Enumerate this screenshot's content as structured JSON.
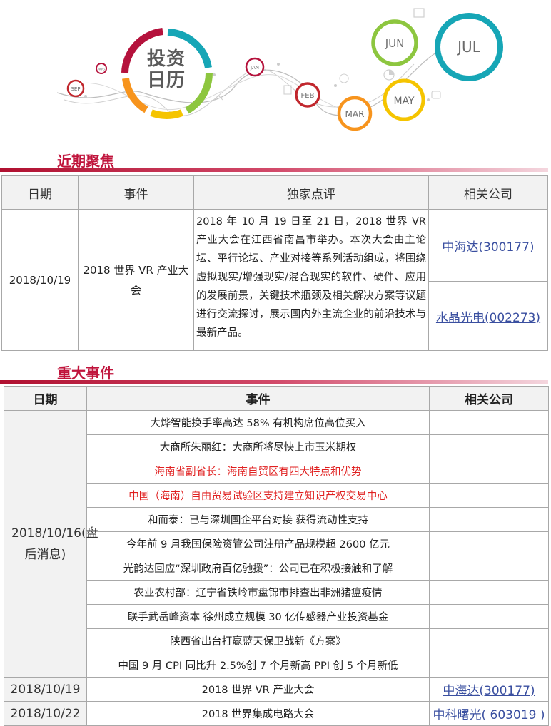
{
  "banner": {
    "brand_line1": "投资",
    "brand_line2": "日历",
    "months": {
      "sep": "SEP",
      "aug": "AUG",
      "jan": "JAN",
      "feb": "FEB",
      "mar": "MAR",
      "may": "MAY",
      "jun": "JUN",
      "jul": "JUL"
    },
    "colors": {
      "jun": "#8dc63f",
      "jul": "#16a6b6",
      "may": "#f5c400",
      "mar": "#f7941d",
      "feb": "#c1272d",
      "jan": "#b5123c",
      "sep": "#c1272d",
      "aug": "#b5123c"
    }
  },
  "focus": {
    "title": "近期聚焦",
    "headers": [
      "日期",
      "事件",
      "独家点评",
      "相关公司"
    ],
    "row": {
      "date": "2018/10/19",
      "event": "2018 世界 VR 产业大会",
      "comment": "2018 年 10 月 19 日至 21 日，2018 世界 VR 产业大会在江西省南昌市举办。本次大会由主论坛、平行论坛、产业对接等系列活动组成，将围绕虚拟现实/增强现实/混合现实的软件、硬件、应用的发展前景，关键技术瓶颈及相关解决方案等议题进行交流探讨，展示国内外主流企业的前沿技术与最新产品。",
      "companies": [
        "中海达(300177)",
        "水晶光电(002273)"
      ]
    }
  },
  "major": {
    "title": "重大事件",
    "headers": [
      "日期",
      "事件",
      "相关公司"
    ],
    "group_date": "2018/10/16(盘后消息)",
    "group_events": [
      {
        "text": "大烨智能换手率高达 58%  有机构席位高位买入",
        "highlight": false
      },
      {
        "text": "大商所朱丽红：大商所将尽快上市玉米期权",
        "highlight": false
      },
      {
        "text": "海南省副省长：海南自贸区有四大特点和优势",
        "highlight": true
      },
      {
        "text": "中国（海南）自由贸易试验区支持建立知识产权交易中心",
        "highlight": true
      },
      {
        "text": "和而泰：已与深圳国企平台对接  获得流动性支持",
        "highlight": false
      },
      {
        "text": "今年前 9 月我国保险资管公司注册产品规模超 2600 亿元",
        "highlight": false
      },
      {
        "text": "光韵达回应“深圳政府百亿驰援”：公司已在积极接触和了解",
        "highlight": false
      },
      {
        "text": "农业农村部：辽宁省铁岭市盘锦市排查出非洲猪瘟疫情",
        "highlight": false
      },
      {
        "text": "联手武岳峰资本  徐州成立规模 30 亿传感器产业投资基金",
        "highlight": false
      },
      {
        "text": "陕西省出台打赢蓝天保卫战新《方案》",
        "highlight": false
      },
      {
        "text": "中国 9 月 CPI 同比升 2.5%创 7 个月新高  PPI 创 5 个月新低",
        "highlight": false
      }
    ],
    "rows": [
      {
        "date": "2018/10/19",
        "event": "2018 世界 VR 产业大会",
        "company": "中海达(300177)"
      },
      {
        "date": "2018/10/22",
        "event": "2018 世界集成电路大会",
        "company": "中科曙光( 603019 )"
      }
    ]
  }
}
